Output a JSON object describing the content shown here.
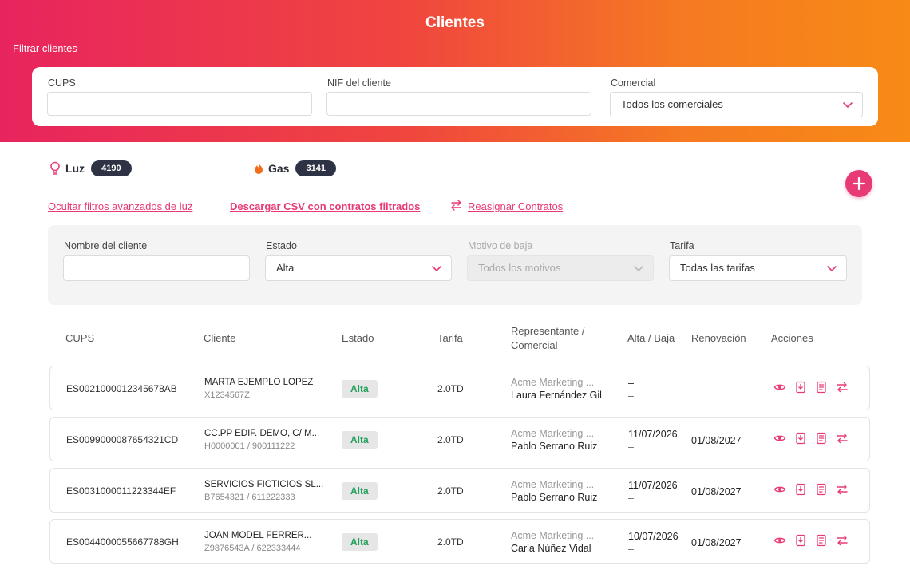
{
  "header": {
    "title": "Clientes",
    "filter_caption": "Filtrar clientes"
  },
  "filters": {
    "cups_label": "CUPS",
    "cups_value": "",
    "nif_label": "NIF del cliente",
    "nif_value": "",
    "comercial_label": "Comercial",
    "comercial_value": "Todos los comerciales"
  },
  "counters": {
    "luz": {
      "label": "Luz",
      "count": "4190"
    },
    "gas": {
      "label": "Gas",
      "count": "3141"
    }
  },
  "links": {
    "hide_filters": "Ocultar filtros avanzados de luz",
    "download_csv": "Descargar CSV con contratos filtrados",
    "reassign": "Reasignar Contratos"
  },
  "advanced": {
    "nombre_label": "Nombre del cliente",
    "nombre_value": "",
    "estado_label": "Estado",
    "estado_value": "Alta",
    "motivo_label": "Motivo de baja",
    "motivo_value": "Todos los motivos",
    "tarifa_label": "Tarifa",
    "tarifa_value": "Todas las tarifas"
  },
  "table": {
    "headers": {
      "cups": "CUPS",
      "cliente": "Cliente",
      "estado": "Estado",
      "tarifa": "Tarifa",
      "rep_line1": "Representante /",
      "rep_line2": "Comercial",
      "alta": "Alta / Baja",
      "renovacion": "Renovación",
      "acciones": "Acciones"
    },
    "rows": [
      {
        "cups": "ES0021000012345678AB",
        "name": "MARTA EJEMPLO LÓPEZ",
        "sub": "X1234567Z",
        "estado": "Alta",
        "tarifa": "2.0TD",
        "rep": "Acme Marketing ...",
        "comercial": "Laura Fernández Gil",
        "alta": "–",
        "baja": "–",
        "renovacion": "–"
      },
      {
        "cups": "ES0099000087654321CD",
        "name": "CC.PP EDIF. DEMO, C/ M...",
        "sub": "H0000001 / 900111222",
        "estado": "Alta",
        "tarifa": "2.0TD",
        "rep": "Acme Marketing ...",
        "comercial": "Pablo Serrano Ruiz",
        "alta": "11/07/2026",
        "baja": "–",
        "renovacion": "01/08/2027"
      },
      {
        "cups": "ES0031000011223344EF",
        "name": "SERVICIOS FICTICIOS SL...",
        "sub": "B7654321 / 611222333",
        "estado": "Alta",
        "tarifa": "2.0TD",
        "rep": "Acme Marketing ...",
        "comercial": "Pablo Serrano Ruiz",
        "alta": "11/07/2026",
        "baja": "–",
        "renovacion": "01/08/2027"
      },
      {
        "cups": "ES0044000055667788GH",
        "name": "JOAN MODEL FERRER...",
        "sub": "Z9876543A / 622333444",
        "estado": "Alta",
        "tarifa": "2.0TD",
        "rep": "Acme Marketing ...",
        "comercial": "Carla Núñez Vidal",
        "alta": "10/07/2026",
        "baja": "–",
        "renovacion": "01/08/2027"
      }
    ]
  },
  "colors": {
    "accent": "#e83a74",
    "gradient_start": "#e8245e",
    "gradient_end": "#f88a16",
    "badge_bg": "#2d3344",
    "status_green": "#23a15c"
  },
  "icons": {
    "luz": "lightbulb-icon",
    "gas": "flame-icon",
    "add": "plus-icon",
    "view": "eye-icon",
    "download": "download-doc-icon",
    "document": "document-icon",
    "reassign": "swap-arrows-icon",
    "dropdown": "chevron-down-icon"
  }
}
